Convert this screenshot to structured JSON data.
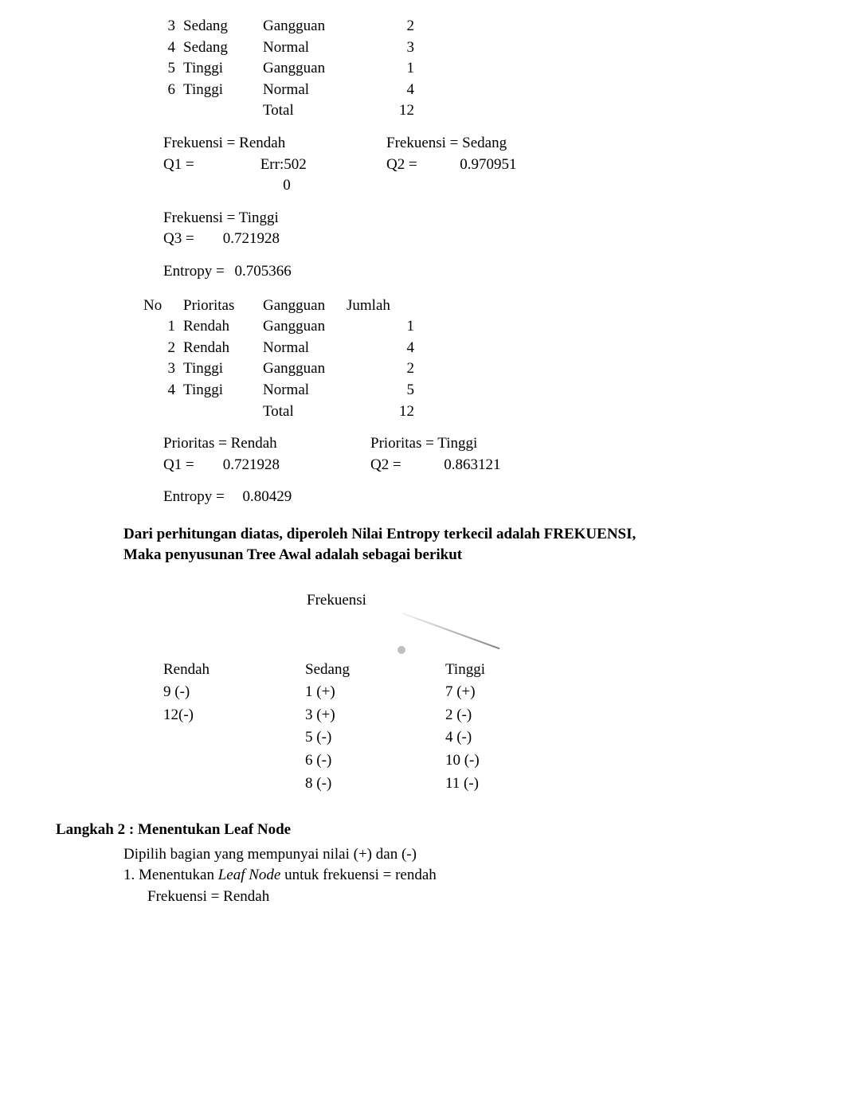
{
  "table1": {
    "rows": [
      {
        "no": "3",
        "c1": "Sedang",
        "c2": "Gangguan",
        "c3": "2"
      },
      {
        "no": "4",
        "c1": "Sedang",
        "c2": "Normal",
        "c3": "3"
      },
      {
        "no": "5",
        "c1": "Tinggi",
        "c2": "Gangguan",
        "c3": "1"
      },
      {
        "no": "6",
        "c1": "Tinggi",
        "c2": "Normal",
        "c3": "4"
      }
    ],
    "total_label": "Total",
    "total_value": "12"
  },
  "freq_calc": {
    "left1_label": "Frekuensi =  Rendah",
    "left1_q": "Q1 =",
    "left1_val1": "Err:502",
    "left1_val2": "0",
    "right1_label": "Frekuensi = Sedang",
    "right1_q": "Q2 =",
    "right1_val": "0.970951",
    "left2_label": "Frekuensi = Tinggi",
    "left2_q": "Q3 =",
    "left2_val": "0.721928",
    "entropy_label": "Entropy =",
    "entropy_val": "0.705366"
  },
  "table2": {
    "headers": {
      "no": "No",
      "c1": "Prioritas",
      "c2": "Gangguan",
      "c3": "Jumlah"
    },
    "rows": [
      {
        "no": "1",
        "c1": "Rendah",
        "c2": "Gangguan",
        "c3": "1"
      },
      {
        "no": "2",
        "c1": "Rendah",
        "c2": "Normal",
        "c3": "4"
      },
      {
        "no": "3",
        "c1": "Tinggi",
        "c2": "Gangguan",
        "c3": "2"
      },
      {
        "no": "4",
        "c1": "Tinggi",
        "c2": "Normal",
        "c3": "5"
      }
    ],
    "total_label": "Total",
    "total_value": "12"
  },
  "pri_calc": {
    "left_label": "Prioritas = Rendah",
    "left_q": "Q1 =",
    "left_val": "0.721928",
    "right_label": "Prioritas = Tinggi",
    "right_q": "Q2 =",
    "right_val": "0.863121",
    "entropy_label": "Entropy =",
    "entropy_val": "0.80429"
  },
  "conclusion": {
    "line1": "Dari perhitungan diatas, diperoleh Nilai Entropy terkecil adalah FREKUENSI,",
    "line2": "Maka penyusunan Tree Awal adalah sebagai berikut"
  },
  "tree": {
    "root": "Frekuensi",
    "branches": [
      {
        "name": "Rendah",
        "items": [
          "9 (-)",
          "12(-)"
        ]
      },
      {
        "name": "Sedang",
        "items": [
          "1 (+)",
          "3 (+)",
          "5 (-)",
          "6 (-)",
          "8 (-)"
        ]
      },
      {
        "name": "Tinggi",
        "items": [
          "7 (+)",
          "2 (-)",
          "4 (-)",
          "10 (-)",
          "11 (-)"
        ]
      }
    ]
  },
  "step2": {
    "title": "Langkah 2 : Menentukan Leaf Node",
    "line1": "Dipilih bagian yang mempunyai nilai (+) dan (-)",
    "line2a": "1. Menentukan ",
    "line2b": "Leaf Node",
    "line2c": " untuk frekuensi = rendah",
    "line3": "Frekuensi = Rendah"
  }
}
